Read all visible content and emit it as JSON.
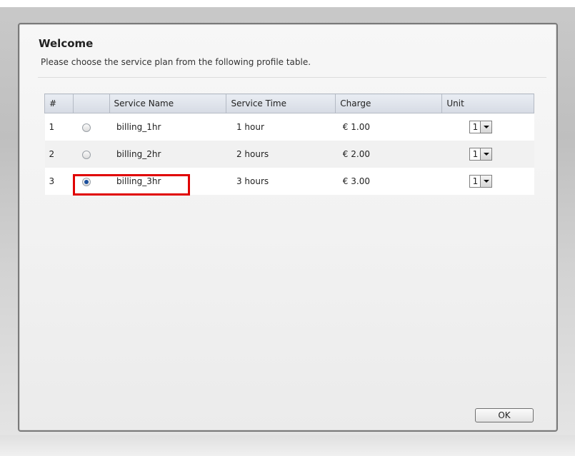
{
  "dialog": {
    "title": "Welcome",
    "subtitle": "Please choose the service plan from the following profile table."
  },
  "table": {
    "headers": [
      "#",
      "",
      "Service Name",
      "Service Time",
      "Charge",
      "Unit"
    ],
    "rows": [
      {
        "num": "1",
        "selected": false,
        "name": "billing_1hr",
        "time": "1 hour",
        "charge": "€ 1.00",
        "unit": "1"
      },
      {
        "num": "2",
        "selected": false,
        "name": "billing_2hr",
        "time": "2 hours",
        "charge": "€ 2.00",
        "unit": "1"
      },
      {
        "num": "3",
        "selected": true,
        "name": "billing_3hr",
        "time": "3 hours",
        "charge": "€ 3.00",
        "unit": "1"
      }
    ]
  },
  "buttons": {
    "ok_label": "OK"
  },
  "colors": {
    "highlight": "#e00000",
    "header_bg": "#d6dbe4"
  },
  "icons": {
    "unit_dropdown": "chevron-down-icon",
    "plan_selector": "radio-icon"
  }
}
